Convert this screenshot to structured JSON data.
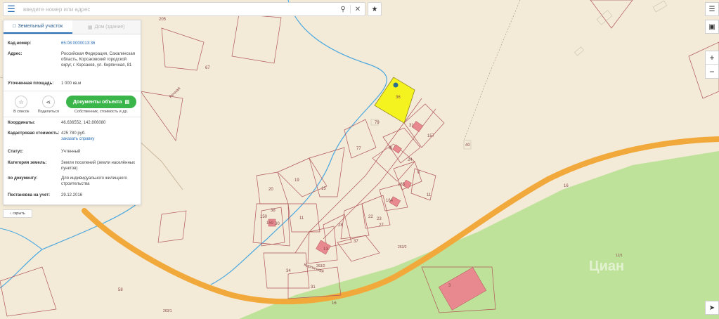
{
  "search": {
    "placeholder": "введите номер или адрес"
  },
  "icons": {
    "menu": "menu-icon",
    "search": "search-icon",
    "clear": "close-icon",
    "star": "star-icon",
    "layers": "layers-icon",
    "fullscreen": "fullscreen-icon",
    "locate": "locate-icon"
  },
  "panel": {
    "tabs": [
      {
        "label": "Земельный участок"
      },
      {
        "label": "Дом (здание)"
      }
    ],
    "fields": [
      {
        "key": "Кад.номер:",
        "value": "65:08:0000013:36"
      },
      {
        "key": "Адрес:",
        "value": "Российская Федерация, Сахалинская область, Корсаковский городской округ, г. Корсаков, ул. Кирпичная, 81"
      },
      {
        "key": "Уточненная площадь:",
        "value": "1 000 кв.м"
      }
    ],
    "actions": {
      "list": "В список",
      "share": "Поделиться",
      "docs": "Документы объекта",
      "docs_sub": "Собственник, стоимость и др."
    },
    "details": [
      {
        "key": "Координаты:",
        "value": "46.636552, 142.806080"
      },
      {
        "key": "Кадастровая стоимость:",
        "value": "425 780 руб.",
        "link": "заказать справку"
      },
      {
        "key": "Статус:",
        "value": "Учтенный"
      },
      {
        "key": "Категория земель:",
        "value": "Земли поселений (земли населённых пунктов)"
      },
      {
        "key": "по документу:",
        "value": "Для индивидуального жилищного строительства"
      },
      {
        "key": "Постановка на учет:",
        "value": "29.12.2016"
      }
    ],
    "hide": "скрыть"
  },
  "controls": {
    "zoom_in": "+",
    "zoom_out": "−"
  },
  "map": {
    "colors": {
      "background": "#f3ead7",
      "road": "#f2a93b",
      "green": "#bfe29a",
      "selected": "#f4f21f",
      "building": "#e8888f",
      "parcel": "#b0585a",
      "river": "#4aa8e0"
    },
    "labels": {
      "parcels": [
        "36",
        "79",
        "31",
        "157",
        "8",
        "9",
        "24",
        "6",
        "165",
        "11",
        "164",
        "27",
        "22",
        "23",
        "28",
        "37",
        "13",
        "19",
        "15",
        "20",
        "150",
        "38",
        "159",
        "30",
        "11",
        "34",
        "31",
        "77",
        "40",
        "16",
        "12/1",
        "3",
        "263/2",
        "263/2",
        "263/1",
        "58",
        "67",
        "205",
        "16"
      ],
      "streets": [
        "Речная",
        "Кирпичная"
      ]
    },
    "watermark": "Циан"
  }
}
